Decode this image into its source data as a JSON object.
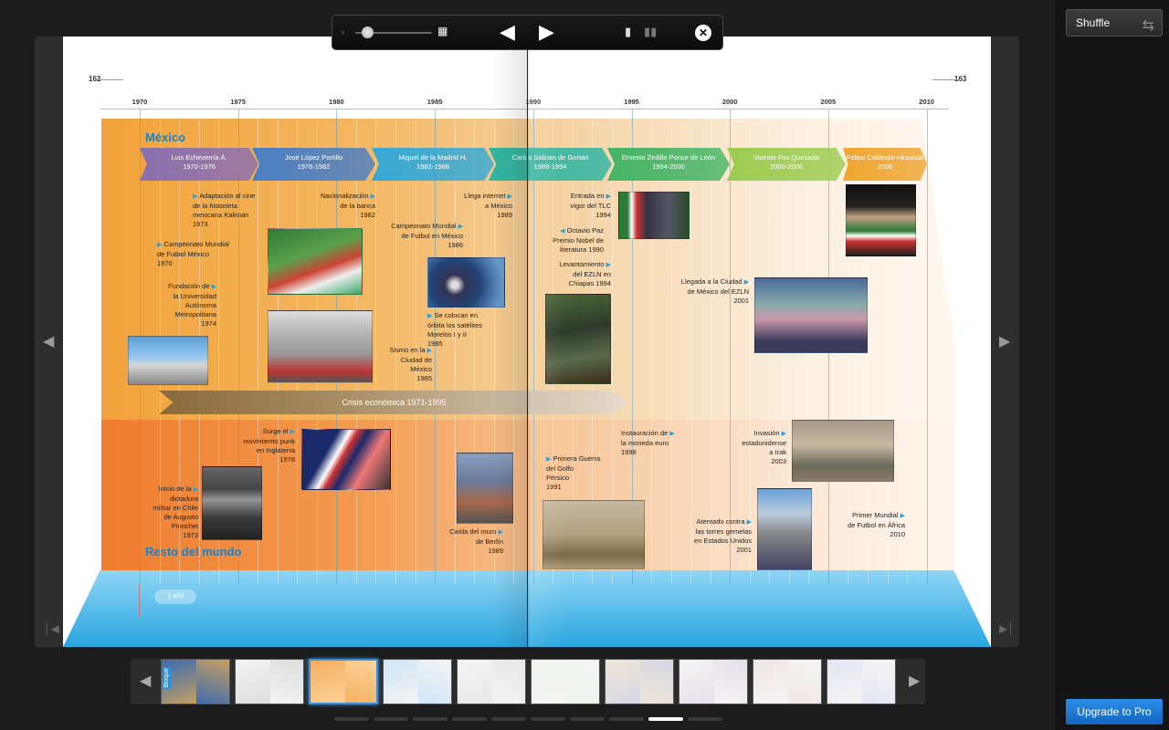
{
  "sidebar": {
    "shuffle_label": "Shuffle",
    "shuffle_icon": "shuffle-icon",
    "upgrade_label": "Upgrade to Pro"
  },
  "toolbar": {
    "zoom_icon": "zoom-out-icon",
    "zoom_level": 0.15,
    "grid_icon": "grid-view-icon",
    "prev_icon": "play-backward-icon",
    "next_icon": "play-forward-icon",
    "single_page_icon": "single-page-icon",
    "double_page_icon": "double-page-icon",
    "close_icon": "close-icon"
  },
  "spread": {
    "left_page_number": "162",
    "right_page_number": "163",
    "years": [
      "1970",
      "1975",
      "1980",
      "1985",
      "1990",
      "1995",
      "2000",
      "2005",
      "2010"
    ],
    "mexico_title": "México",
    "world_title": "Resto del mundo",
    "crisis_label": "Crisis económica 1971-1995",
    "scale_label": "1 año",
    "presidents": [
      {
        "name": "Luis Echeverría Á.",
        "years": "1970-1976"
      },
      {
        "name": "José López Portillo",
        "years": "1976-1982"
      },
      {
        "name": "Miguel de la Madrid H.",
        "years": "1982-1988"
      },
      {
        "name": "Carlos Salinas de Gortari",
        "years": "1988-1994"
      },
      {
        "name": "Ernesto Zedillo Ponce de León",
        "years": "1994-2000"
      },
      {
        "name": "Vicente Fox Quesada",
        "years": "2000-2006"
      },
      {
        "name": "Felipe Calderón Hinojosa",
        "years": "2006"
      }
    ],
    "mexico_events": {
      "kaliman": {
        "line1": "Adaptación al cine",
        "line2": "de la historieta",
        "line3a": "mexicana ",
        "line3b": "Kalimán",
        "year": "1973"
      },
      "banca": {
        "line1": "Nacionalización",
        "line2": "de la banca",
        "year": "1982"
      },
      "internet": {
        "line1": "Llega internet",
        "line2": "a México",
        "year": "1989"
      },
      "tlc": {
        "line1": "Entrada en",
        "line2": "vigor del TLC",
        "year": "1994"
      },
      "mundial70": {
        "line1": "Campeonato Mundial",
        "line2": "de Futbol México",
        "year": "1970"
      },
      "mundial86": {
        "line1": "Campeonato Mundial",
        "line2": "de Futbol en México",
        "year": "1986"
      },
      "paz": {
        "line1": "Octavio Paz",
        "line2": "Premio Nobel de",
        "line3": "literatura 1990"
      },
      "uam": {
        "line1": "Fundación de",
        "line2": "la Universidad",
        "line3": "Autónoma",
        "line4": "Metropolitana",
        "year": "1974"
      },
      "ezln94": {
        "line1": "Levantamiento",
        "line2": "del EZLN en",
        "line3": "Chiapas 1994"
      },
      "ezln01": {
        "line1": "Llegada a la Ciudad",
        "line2": "de México del EZLN",
        "year": "2001"
      },
      "satelites": {
        "line1": "Se colocan en",
        "line2": "órbita los satélites",
        "line3": "Morelos I y II",
        "year": "1985"
      },
      "sismo": {
        "line1": "Sismo en la",
        "line2": "Ciudad de",
        "line3": "México",
        "year": "1985"
      }
    },
    "world_events": {
      "punk": {
        "line1": "Surge el",
        "line2": "movimiento punk",
        "line3": "en Inglaterra",
        "year": "1978"
      },
      "euro": {
        "line1": "Instauración de",
        "line2": "la moneda euro",
        "year": "1998"
      },
      "irak": {
        "line1": "Invasión",
        "line2": "estadunidense",
        "line3": "a Irak",
        "year": "2003"
      },
      "golfo": {
        "line1": "Primera Guerra",
        "line2": "del Golfo",
        "line3": "Pérsico",
        "year": "1991"
      },
      "pinochet": {
        "line1": "Inicio de la",
        "line2": "dictadura",
        "line3": "militar en Chile",
        "line4": "de Augusto",
        "line5": "Pinochet",
        "year": "1973"
      },
      "atentado": {
        "line1": "Atentado contra",
        "line2": "las torres gemelas",
        "line3": "en Estados Unidos",
        "year": "2001"
      },
      "mundial2010": {
        "line1": "Primer Mundial",
        "line2": "de Futbol en África",
        "year": "2010"
      },
      "berlin": {
        "line1": "Caída del muro",
        "line2": "de Berlín",
        "year": "1989"
      }
    }
  },
  "viewer": {
    "prev_page_icon": "chevron-left-icon",
    "next_page_icon": "chevron-right-icon",
    "first_page_icon": "first-page-icon",
    "last_page_icon": "last-page-icon"
  },
  "thumbnails": {
    "prev_icon": "chevron-left-icon",
    "next_icon": "chevron-right-icon",
    "first_label": "Bloque",
    "count": 10,
    "selected_index": 2
  },
  "pagination": {
    "count": 10,
    "active_index": 8
  }
}
